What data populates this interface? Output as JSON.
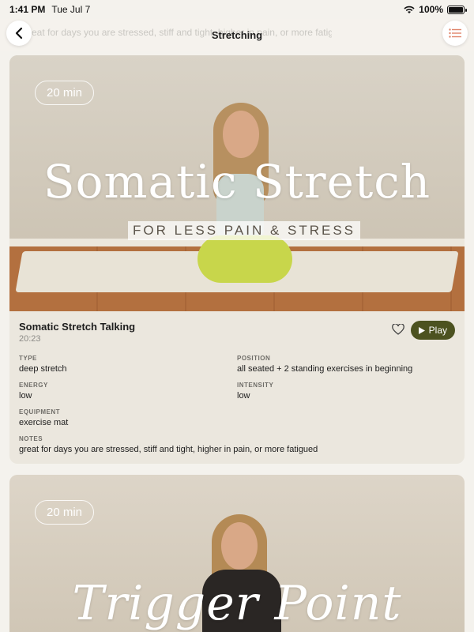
{
  "status": {
    "time": "1:41 PM",
    "date": "Tue Jul 7",
    "battery": "100%"
  },
  "nav": {
    "title": "Stretching",
    "ghost_text": "eat for days you are stressed, stiff and tight, higher in pain, or more fatigued"
  },
  "videos": [
    {
      "duration_pill": "20 min",
      "hero_title": "Somatic Stretch",
      "hero_subtitle": "FOR LESS PAIN & STRESS",
      "title": "Somatic Stretch Talking",
      "duration": "20:23",
      "play_label": "Play",
      "fields": {
        "type_label": "TYPE",
        "type": "deep stretch",
        "position_label": "POSITION",
        "position": "all seated + 2 standing exercises in beginning",
        "energy_label": "ENERGY",
        "energy": "low",
        "intensity_label": "INTENSITY",
        "intensity": "low",
        "equipment_label": "EQUIPMENT",
        "equipment": "exercise mat",
        "notes_label": "NOTES",
        "notes": "great for days you are stressed, stiff and tight, higher in pain, or more fatigued"
      }
    },
    {
      "duration_pill": "20 min",
      "hero_title": "Trigger Point"
    }
  ]
}
